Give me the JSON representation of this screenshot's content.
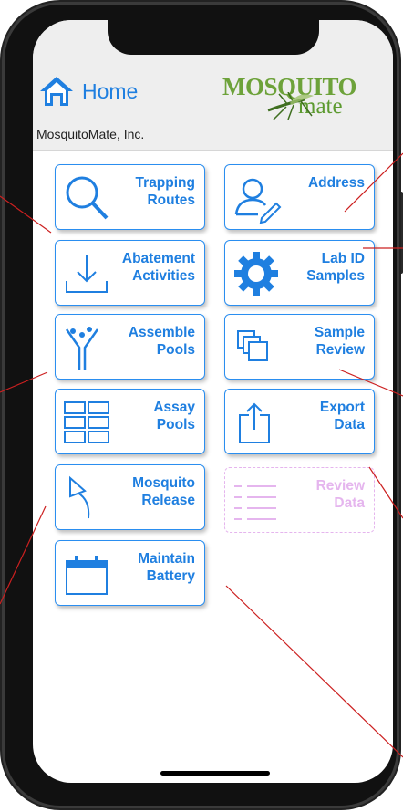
{
  "header": {
    "home_label": "Home",
    "company": "MosquitoMate, Inc.",
    "logo_top": "MOSQUITO",
    "logo_bottom": "mate"
  },
  "tiles": [
    {
      "label": "Trapping\nRoutes",
      "icon": "search-icon",
      "enabled": true
    },
    {
      "label": "Address",
      "icon": "person-pencil-icon",
      "enabled": true
    },
    {
      "label": "Abatement\nActivities",
      "icon": "download-tray-icon",
      "enabled": true
    },
    {
      "label": "Lab ID\nSamples",
      "icon": "gear-icon",
      "enabled": true
    },
    {
      "label": "Assemble\nPools",
      "icon": "merge-arrows-icon",
      "enabled": true
    },
    {
      "label": "Sample\nReview",
      "icon": "copy-icon",
      "enabled": true
    },
    {
      "label": "Assay\nPools",
      "icon": "grid-icon",
      "enabled": true
    },
    {
      "label": "Export\nData",
      "icon": "export-icon",
      "enabled": true
    },
    {
      "label": "Mosquito\nRelease",
      "icon": "return-arrow-icon",
      "enabled": true
    },
    {
      "label": "Review\nData",
      "icon": "list-icon",
      "enabled": false
    },
    {
      "label": "Maintain\nBattery",
      "icon": "calendar-icon",
      "enabled": true
    }
  ],
  "colors": {
    "accent": "#1f7fe0",
    "border": "#2a8ef0",
    "disabled": "#e5b5ee",
    "annotation_line": "#cc2020",
    "logo_green": "#6da23a"
  }
}
